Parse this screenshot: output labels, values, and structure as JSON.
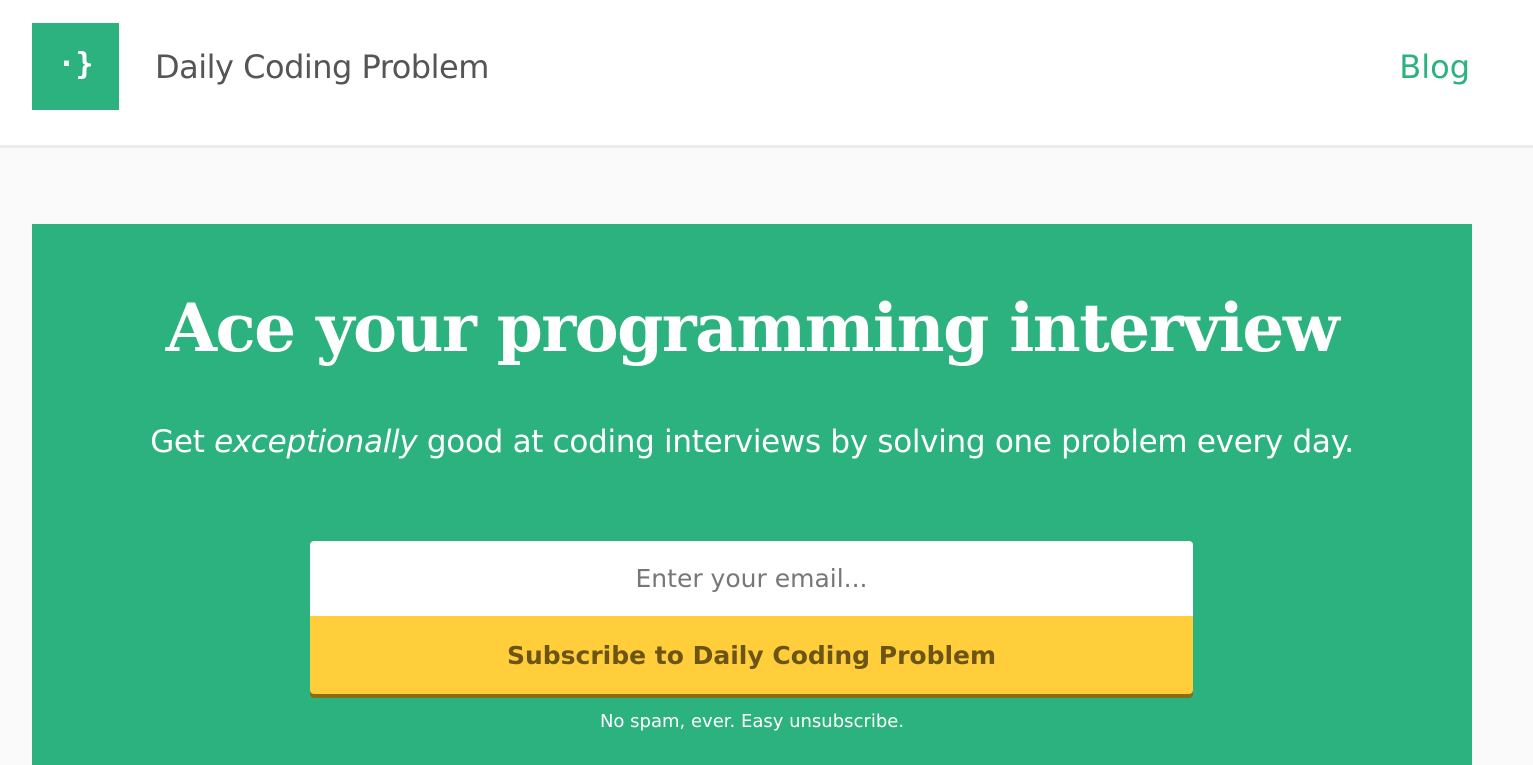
{
  "header": {
    "logo_glyph": "·}",
    "brand_name": "Daily Coding Problem",
    "nav": {
      "blog_label": "Blog"
    }
  },
  "hero": {
    "title": "Ace your programming interview",
    "subtitle": {
      "before": "Get ",
      "emphasis": "exceptionally",
      "after": " good at coding interviews by solving one problem every day."
    },
    "form": {
      "email_placeholder": "Enter your email...",
      "subscribe_label": "Subscribe to Daily Coding Problem"
    },
    "fine_print": "No spam, ever. Easy unsubscribe."
  },
  "colors": {
    "brand_green": "#2cb27e",
    "button_yellow": "#ffce3a",
    "button_text": "#6b5414",
    "page_bg": "#fafafa"
  },
  "icons": {
    "logo": "curly-brace-logo-icon"
  }
}
